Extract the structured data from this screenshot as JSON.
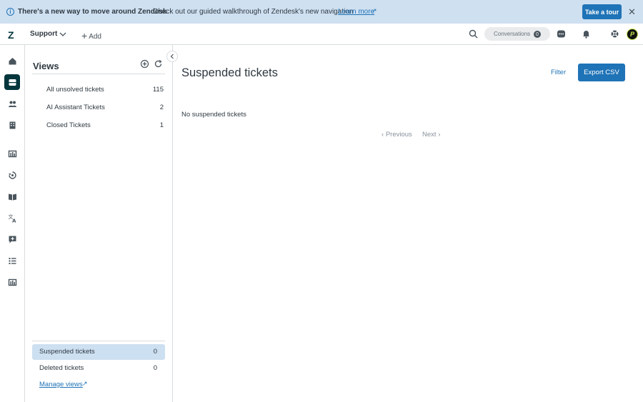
{
  "banner": {
    "title": "There's a new way to move around Zendesk",
    "message": "Check out our guided walkthrough of Zendesk's new navigation",
    "link": "Learn more",
    "tour_button": "Take a tour"
  },
  "topbar": {
    "product": "Support",
    "add_label": "Add",
    "conversations_label": "Conversations",
    "conversations_count": "0",
    "avatar_letter": "P"
  },
  "views": {
    "title": "Views",
    "items": [
      {
        "label": "All unsolved tickets",
        "count": "115"
      },
      {
        "label": "AI Assistant Tickets",
        "count": "2"
      },
      {
        "label": "Closed Tickets",
        "count": "1"
      }
    ],
    "bottom_items": [
      {
        "label": "Suspended tickets",
        "count": "0"
      },
      {
        "label": "Deleted tickets",
        "count": "0"
      }
    ],
    "manage_link": "Manage views"
  },
  "main": {
    "title": "Suspended tickets",
    "filter_label": "Filter",
    "export_label": "Export CSV",
    "empty_message": "No suspended tickets",
    "previous_label": "Previous",
    "next_label": "Next"
  },
  "rail_icons": [
    "home-icon",
    "tickets-icon",
    "customers-icon",
    "organizations-icon",
    "reporting-icon",
    "routing-icon",
    "knowledge-icon",
    "translate-icon",
    "messaging-icon",
    "lists-icon",
    "reports-icon"
  ],
  "colors": {
    "accent": "#1f73b7",
    "banner_bg": "#cfe0f1",
    "selected_row": "#cde0f1",
    "brand_dark": "#03363d"
  }
}
